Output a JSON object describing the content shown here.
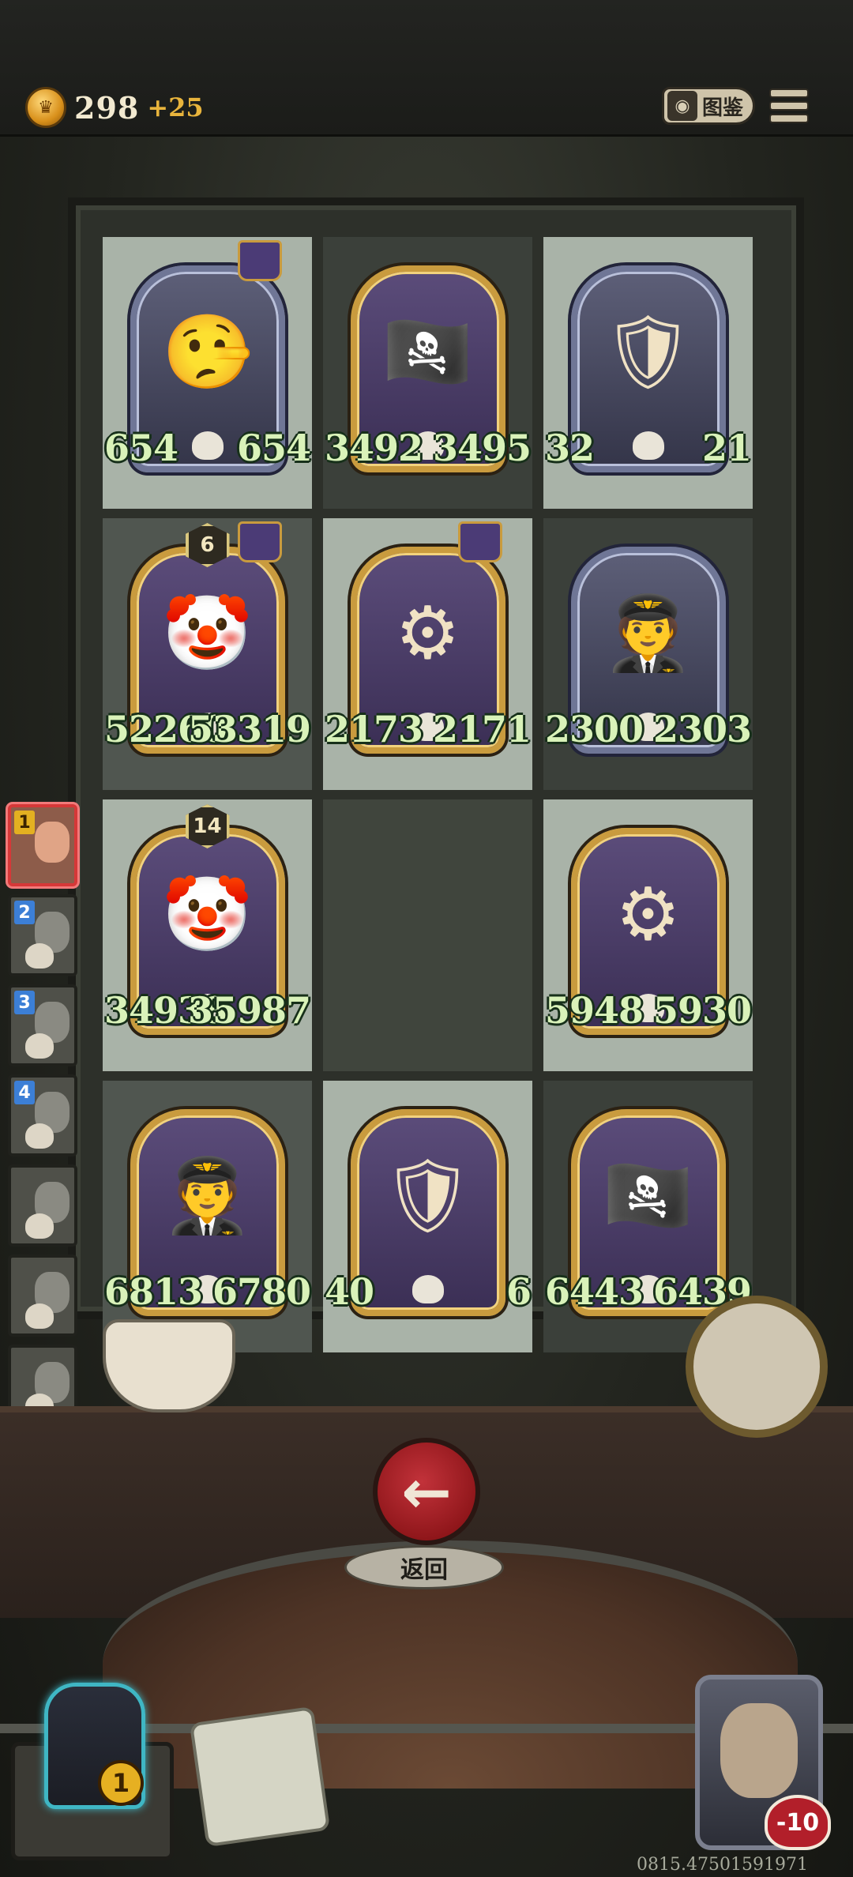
{
  "header": {
    "gold_amount": "298",
    "gold_bonus": "+25",
    "codex_label": "图鉴",
    "codex_icon": "book-icon",
    "menu_icon": "hamburger-menu-icon"
  },
  "board": {
    "cells": [
      {
        "atk": "654",
        "hp": "654",
        "tone": "light",
        "frame": "silver",
        "glyph": "🤥",
        "level": "",
        "hat": true
      },
      {
        "atk": "3492",
        "hp": "3495",
        "tone": "dark",
        "frame": "gold",
        "glyph": "🏴‍☠️",
        "level": "",
        "hat": false
      },
      {
        "atk": "32",
        "hp": "21",
        "tone": "light",
        "frame": "silver",
        "glyph": "🛡",
        "level": "",
        "hat": false
      },
      {
        "atk": "52260",
        "hp": "53319",
        "tone": "mid",
        "frame": "gold",
        "glyph": "🤡",
        "level": "6",
        "hat": true
      },
      {
        "atk": "2173",
        "hp": "2171",
        "tone": "light",
        "frame": "gold",
        "glyph": "⚙",
        "level": "",
        "hat": true
      },
      {
        "atk": "2300",
        "hp": "2303",
        "tone": "dark",
        "frame": "silver",
        "glyph": "🧑‍✈️",
        "level": "",
        "hat": false
      },
      {
        "atk": "34938",
        "hp": "35987",
        "tone": "light",
        "frame": "gold",
        "glyph": "🤡",
        "level": "14",
        "hat": false
      },
      {
        "atk": "",
        "hp": "",
        "tone": "empty",
        "frame": "",
        "glyph": "",
        "level": "",
        "hat": false
      },
      {
        "atk": "5948",
        "hp": "5930",
        "tone": "light",
        "frame": "gold",
        "glyph": "⚙",
        "level": "",
        "hat": false
      },
      {
        "atk": "6813",
        "hp": "6780",
        "tone": "mid",
        "frame": "gold",
        "glyph": "🧑‍✈️",
        "level": "",
        "hat": false
      },
      {
        "atk": "40",
        "hp": "6",
        "tone": "light",
        "frame": "gold",
        "glyph": "🛡",
        "level": "",
        "hat": false
      },
      {
        "atk": "6443",
        "hp": "6439",
        "tone": "dark",
        "frame": "gold",
        "glyph": "🏴‍☠️",
        "level": "",
        "hat": false
      }
    ]
  },
  "opponents": [
    {
      "num": "1",
      "active": true
    },
    {
      "num": "2",
      "active": false
    },
    {
      "num": "3",
      "active": false
    },
    {
      "num": "4",
      "active": false
    },
    {
      "num": "",
      "active": false
    },
    {
      "num": "",
      "active": false
    },
    {
      "num": "",
      "active": false
    },
    {
      "num": "",
      "active": false
    }
  ],
  "controls": {
    "back_icon": "←",
    "back_label": "返回"
  },
  "player": {
    "left_hero_count": "1",
    "right_hero_hp": "-10"
  },
  "footer": {
    "id_text": "0815.47501591971"
  }
}
